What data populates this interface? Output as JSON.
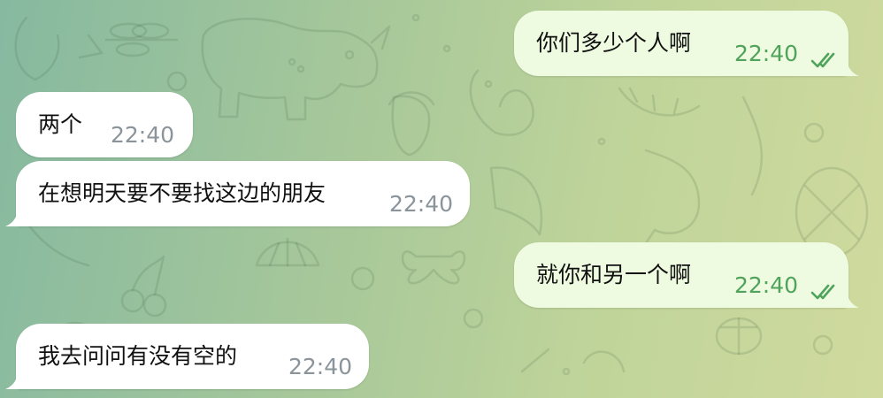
{
  "chat": {
    "messages": [
      {
        "id": "m1",
        "direction": "outgoing",
        "text": "你们多少个人啊",
        "time": "22:40",
        "status": "read"
      },
      {
        "id": "m2",
        "direction": "incoming",
        "text": "两个",
        "time": "22:40"
      },
      {
        "id": "m3",
        "direction": "incoming",
        "text": "在想明天要不要找这边的朋友",
        "time": "22:40"
      },
      {
        "id": "m4",
        "direction": "outgoing",
        "text": "就你和另一个啊",
        "time": "22:40",
        "status": "read"
      },
      {
        "id": "m5",
        "direction": "incoming",
        "text": "我去问问有没有空的",
        "time": "22:40"
      }
    ]
  },
  "theme": {
    "incoming_bubble": "#ffffff",
    "outgoing_bubble": "#eefbe0",
    "outgoing_time_color": "#4fa35a",
    "incoming_time_color": "#8a949a",
    "read_check_color": "#4fa35a"
  },
  "icons": {
    "read_status": "double-check-icon"
  }
}
